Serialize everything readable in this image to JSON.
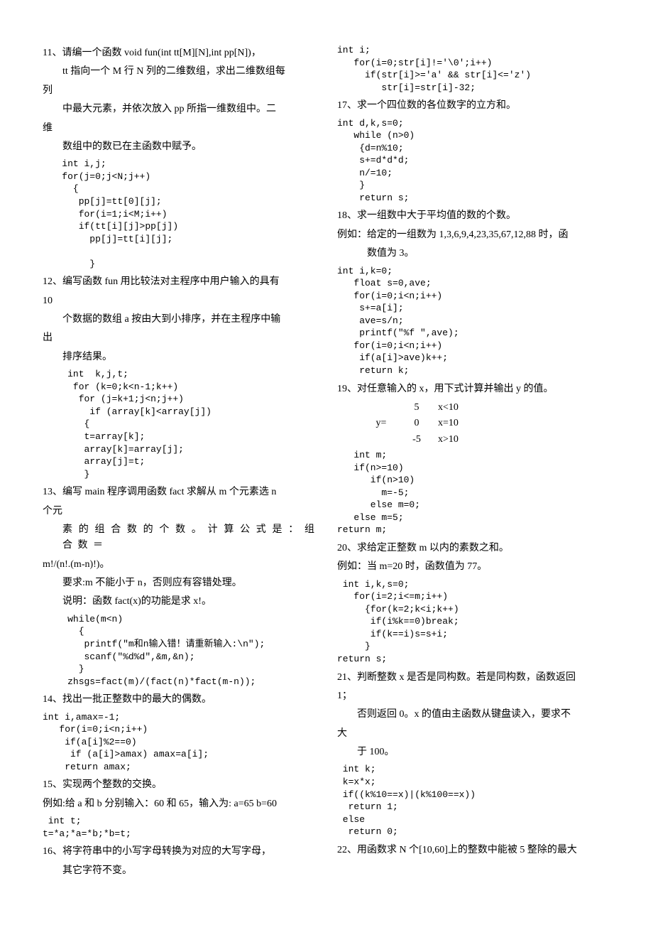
{
  "left": {
    "p11": {
      "l1": "11、请编一个函数 void fun(int tt[M][N],int pp[N])，",
      "l2": "tt 指向一个 M 行 N 列的二维数组，求出二维数组每",
      "l3": "列",
      "l4": "中最大元素，并依次放入 pp 所指一维数组中。二",
      "l5": "维",
      "l6": "数组中的数已在主函数中赋予。",
      "code": " int i,j;\n for(j=0;j<N;j++)\n   {\n    pp[j]=tt[0][j];\n    for(i=1;i<M;i++)\n    if(tt[i][j]>pp[j])\n      pp[j]=tt[i][j];\n\n      }"
    },
    "p12": {
      "l1": "12、编写函数 fun 用比较法对主程序中用户输入的具有",
      "l2": "10",
      "l3": "个数据的数组 a 按由大到小排序，并在主程序中输",
      "l4": "出",
      "l5": "排序结果。",
      "code": "  int  k,j,t;\n   for (k=0;k<n-1;k++)\n    for (j=k+1;j<n;j++)\n      if (array[k]<array[j])\n     {\n     t=array[k];\n     array[k]=array[j];\n     array[j]=t;\n     }"
    },
    "p13": {
      "l1": "13、编写 main 程序调用函数 fact 求解从 m 个元素选 n",
      "l2": "个元",
      "l3": "素 的 组 合 数 的 个 数 。 计 算 公 式 是 ： 组 合 数 ＝",
      "l4": "m!/(n!.(m-n)!)。",
      "l5": "要求:m 不能小于 n，否则应有容错处理。",
      "l6": "说明：函数 fact(x)的功能是求 x!。",
      "code": "  while(m<n)\n    {\n     printf(\"m和n输入错！请重新输入:\\n\");\n     scanf(\"%d%d\",&m,&n);\n    }\n  zhsgs=fact(m)/(fact(n)*fact(m-n));"
    },
    "p14": {
      "l1": "14、找出一批正整数中的最大的偶数。",
      "code": "int i,amax=-1;\n   for(i=0;i<n;i++)\n    if(a[i]%2==0)\n     if (a[i]>amax) amax=a[i];\n    return amax;"
    },
    "p15": {
      "l1": "15、实现两个整数的交换。",
      "l2": "例如:给 a 和 b 分别输入：60 和 65，输入为: a=65 b=60",
      "code": " int t;\nt=*a;*a=*b;*b=t;"
    },
    "p16": {
      "l1": "16、将字符串中的小写字母转换为对应的大写字母，",
      "l2": "其它字符不变。"
    }
  },
  "right": {
    "p16code": "int i;\n   for(i=0;str[i]!='\\0';i++)\n     if(str[i]>='a' && str[i]<='z')\n        str[i]=str[i]-32;",
    "p17": {
      "l1": "17、求一个四位数的各位数字的立方和。",
      "code": "int d,k,s=0;\n   while (n>0)\n    {d=n%10;\n    s+=d*d*d;\n    n/=10;\n    }\n    return s;"
    },
    "p18": {
      "l1": "18、求一组数中大于平均值的数的个数。",
      "l2": "例如：给定的一组数为 1,3,6,9,4,23,35,67,12,88 时，函",
      "l3": "数值为 3。",
      "code": "int i,k=0;\n   float s=0,ave;\n   for(i=0;i<n;i++)\n    s+=a[i];\n    ave=s/n;\n    printf(\"%f \",ave);\n   for(i=0;i<n;i++)\n    if(a[i]>ave)k++;\n    return k;"
    },
    "p19": {
      "l1": "19、对任意输入的 x，用下式计算并输出 y 的值。",
      "f_y": "y=",
      "f_c1a": "5",
      "f_c1b": "x<10",
      "f_c2a": "0",
      "f_c2b": "x=10",
      "f_c3a": "-5",
      "f_c3b": "x>10",
      "code": "   int m;\n   if(n>=10)\n      if(n>10)\n        m=-5;\n      else m=0;\n   else m=5;\nreturn m;"
    },
    "p20": {
      "l1": "20、求给定正整数 m 以内的素数之和。",
      "l2": "例如：当 m=20 时，函数值为 77。",
      "code": " int i,k,s=0;\n   for(i=2;i<=m;i++)\n     {for(k=2;k<i;k++)\n      if(i%k==0)break;\n      if(k==i)s=s+i;\n     }\nreturn s;"
    },
    "p21": {
      "l1": "21、判断整数 x 是否是同构数。若是同构数，函数返回",
      "l2": "1；",
      "l3": "否则返回 0。x 的值由主函数从键盘读入，要求不",
      "l4": "大",
      "l5": "于 100。",
      "code": " int k;\n k=x*x;\n if((k%10==x)|(k%100==x))\n  return 1;\n else\n  return 0;"
    },
    "p22": {
      "l1": "22、用函数求 N 个[10,60]上的整数中能被 5 整除的最大"
    }
  }
}
